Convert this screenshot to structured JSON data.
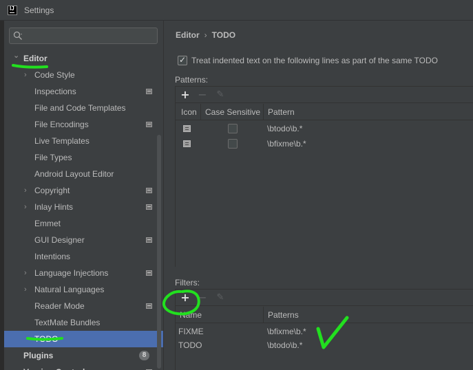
{
  "window": {
    "title": "Settings",
    "app_icon": "intellij-icon"
  },
  "search": {
    "placeholder": "",
    "icon": "search-icon"
  },
  "sidebar": {
    "items": [
      {
        "label": "Editor",
        "bold": true,
        "chevron": "expanded",
        "indent": 1
      },
      {
        "label": "Code Style",
        "chevron": "collapsed",
        "indent": 2
      },
      {
        "label": "Inspections",
        "icon": "doc-icon",
        "indent": 2
      },
      {
        "label": "File and Code Templates",
        "indent": 2
      },
      {
        "label": "File Encodings",
        "icon": "doc-icon",
        "indent": 2
      },
      {
        "label": "Live Templates",
        "indent": 2
      },
      {
        "label": "File Types",
        "indent": 2
      },
      {
        "label": "Android Layout Editor",
        "indent": 2
      },
      {
        "label": "Copyright",
        "chevron": "collapsed",
        "icon": "doc-icon",
        "indent": 2
      },
      {
        "label": "Inlay Hints",
        "chevron": "collapsed",
        "icon": "doc-icon",
        "indent": 2
      },
      {
        "label": "Emmet",
        "indent": 2
      },
      {
        "label": "GUI Designer",
        "icon": "doc-icon",
        "indent": 2
      },
      {
        "label": "Intentions",
        "indent": 2
      },
      {
        "label": "Language Injections",
        "chevron": "collapsed",
        "icon": "doc-icon",
        "indent": 2
      },
      {
        "label": "Natural Languages",
        "chevron": "collapsed",
        "indent": 2
      },
      {
        "label": "Reader Mode",
        "icon": "doc-icon",
        "indent": 2
      },
      {
        "label": "TextMate Bundles",
        "indent": 2
      },
      {
        "label": "TODO",
        "selected": true,
        "indent": 2
      },
      {
        "label": "Plugins",
        "bold": true,
        "badge": "8",
        "indent": 1
      },
      {
        "label": "Version Control",
        "bold": true,
        "chevron": "collapsed",
        "icon": "doc-icon",
        "indent": 1
      }
    ]
  },
  "breadcrumb": {
    "parent": "Editor",
    "separator": "›",
    "current": "TODO"
  },
  "treat_indented": {
    "label": "Treat indented text on the following lines as part of the same TODO",
    "checked": true
  },
  "patterns": {
    "label": "Patterns:",
    "toolbar": {
      "add": "+",
      "remove": "−",
      "edit": "✎"
    },
    "columns": {
      "icon": "Icon",
      "case_sensitive": "Case Sensitive",
      "pattern": "Pattern"
    },
    "rows": [
      {
        "icon": "todo-icon",
        "case_sensitive": false,
        "pattern": "\\btodo\\b.*"
      },
      {
        "icon": "todo-icon",
        "case_sensitive": false,
        "pattern": "\\bfixme\\b.*"
      }
    ]
  },
  "filters": {
    "label": "Filters:",
    "toolbar": {
      "add": "+",
      "remove": "−",
      "edit": "✎"
    },
    "columns": {
      "name": "Name",
      "patterns": "Patterns"
    },
    "rows": [
      {
        "name": "FIXME",
        "patterns": "\\bfixme\\b.*"
      },
      {
        "name": "TODO",
        "patterns": "\\btodo\\b.*"
      }
    ]
  },
  "colors": {
    "annotation_green": "#22e01f",
    "selection": "#4b6eaf",
    "background": "#3c3f41"
  }
}
